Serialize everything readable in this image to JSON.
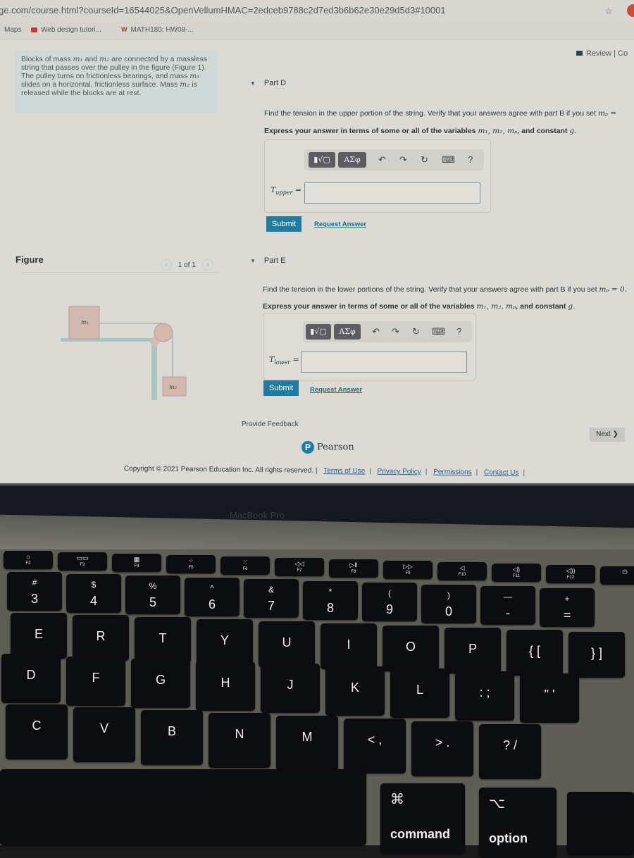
{
  "browser": {
    "url": "ge.com/course.html?courseId=16544025&OpenVellumHMAC=2edceb9788c2d7ed3b6b62e30e29d5d3#10001",
    "bookmarks": [
      {
        "label": "Maps",
        "icon": "maps-icon"
      },
      {
        "label": "Web design tutori...",
        "icon": "youtube-icon"
      },
      {
        "label": "MATH180: HW08-...",
        "icon": "webassign-icon"
      }
    ],
    "star_icon": "☆"
  },
  "header": {
    "review_label": "Review | Co"
  },
  "intro": {
    "text_parts": [
      "Blocks of mass ",
      "m₁",
      " and ",
      "m₂",
      " are connected by a massless string that passes over the pulley in the figure (Figure 1). The pulley turns on frictionless bearings, and mass ",
      "m₁",
      " slides on a horizontal, frictionless surface. Mass ",
      "m₂",
      " is released while the blocks are at rest."
    ]
  },
  "figure": {
    "title": "Figure",
    "pager": "1 of 1",
    "prev": "<",
    "next": ">",
    "labels": {
      "m1": "m₁",
      "m2": "m₂"
    }
  },
  "toolbar": {
    "template_btn": "▮√▢",
    "greek_btn": "ΑΣφ",
    "undo": "↶",
    "redo": "↷",
    "reset": "↻",
    "keyboard": "⌨",
    "help": "?"
  },
  "parts": [
    {
      "title": "Part D",
      "question": "Find the tension in the upper portion of the string. Verify that your answers agree with part B if you set ",
      "question_tail": "mₚ =",
      "instruction": "Express your answer in terms of some or all of the variables ",
      "variables": "m₁, m₂, mₚ",
      "instruction_tail": ", and constant ",
      "constant": "g.",
      "answer_label": "T",
      "answer_sub": "upper",
      "answer_value": "",
      "submit": "Submit",
      "request": "Request Answer"
    },
    {
      "title": "Part E",
      "question": "Find the tension in the lower portions of the string. Verify that your answers agree with part B if you set ",
      "question_tail": "mₚ = 0.",
      "instruction": "Express your answer in terms of some or all of the variables ",
      "variables": "m₁, m₂, mₚ",
      "instruction_tail": ", and constant ",
      "constant": "g.",
      "answer_label": "T",
      "answer_sub": "lower",
      "answer_value": "",
      "submit": "Submit",
      "request": "Request Answer"
    }
  ],
  "feedback": "Provide Feedback",
  "next_button": "Next ❯",
  "pearson": {
    "logo": "P",
    "name": "Pearson"
  },
  "footer": {
    "copyright": "Copyright © 2021 Pearson Education Inc. All rights reserved. |",
    "links": [
      "Terms of Use",
      "Privacy Policy",
      "Permissions",
      "Contact Us"
    ]
  },
  "laptop": {
    "brand": "MacBook Pro",
    "fkeys": [
      {
        "g": "☼",
        "l": "F2"
      },
      {
        "g": "▭▭",
        "l": "F3"
      },
      {
        "g": "▦",
        "l": "F4"
      },
      {
        "g": "⁘",
        "l": "F5"
      },
      {
        "g": "⁙",
        "l": "F6"
      },
      {
        "g": "◁◁",
        "l": "F7"
      },
      {
        "g": "▷ll",
        "l": "F8"
      },
      {
        "g": "▷▷",
        "l": "F9"
      },
      {
        "g": "◁",
        "l": "F10"
      },
      {
        "g": "◁)",
        "l": "F11"
      },
      {
        "g": "◁))",
        "l": "F12"
      },
      {
        "g": "⏻",
        "l": ""
      }
    ],
    "number_keys": [
      {
        "s": "#",
        "m": "3"
      },
      {
        "s": "$",
        "m": "4"
      },
      {
        "s": "%",
        "m": "5"
      },
      {
        "s": "^",
        "m": "6"
      },
      {
        "s": "&",
        "m": "7"
      },
      {
        "s": "*",
        "m": "8"
      },
      {
        "s": "(",
        "m": "9"
      },
      {
        "s": ")",
        "m": "0"
      },
      {
        "s": "—",
        "m": "-"
      },
      {
        "s": "+",
        "m": "="
      }
    ],
    "row_qwerty": [
      "E",
      "R",
      "T",
      "Y",
      "U",
      "I",
      "O",
      "P",
      "{ [",
      "} ]"
    ],
    "row_home": [
      "D",
      "F",
      "G",
      "H",
      "J",
      "K",
      "L",
      ": ;",
      "\" '"
    ],
    "row_bottom": [
      "C",
      "V",
      "B",
      "N",
      "M",
      "< ,",
      "> .",
      "? /"
    ],
    "command": {
      "g": "⌘",
      "l": "command"
    },
    "option": {
      "g": "⌥",
      "l": "option"
    }
  }
}
